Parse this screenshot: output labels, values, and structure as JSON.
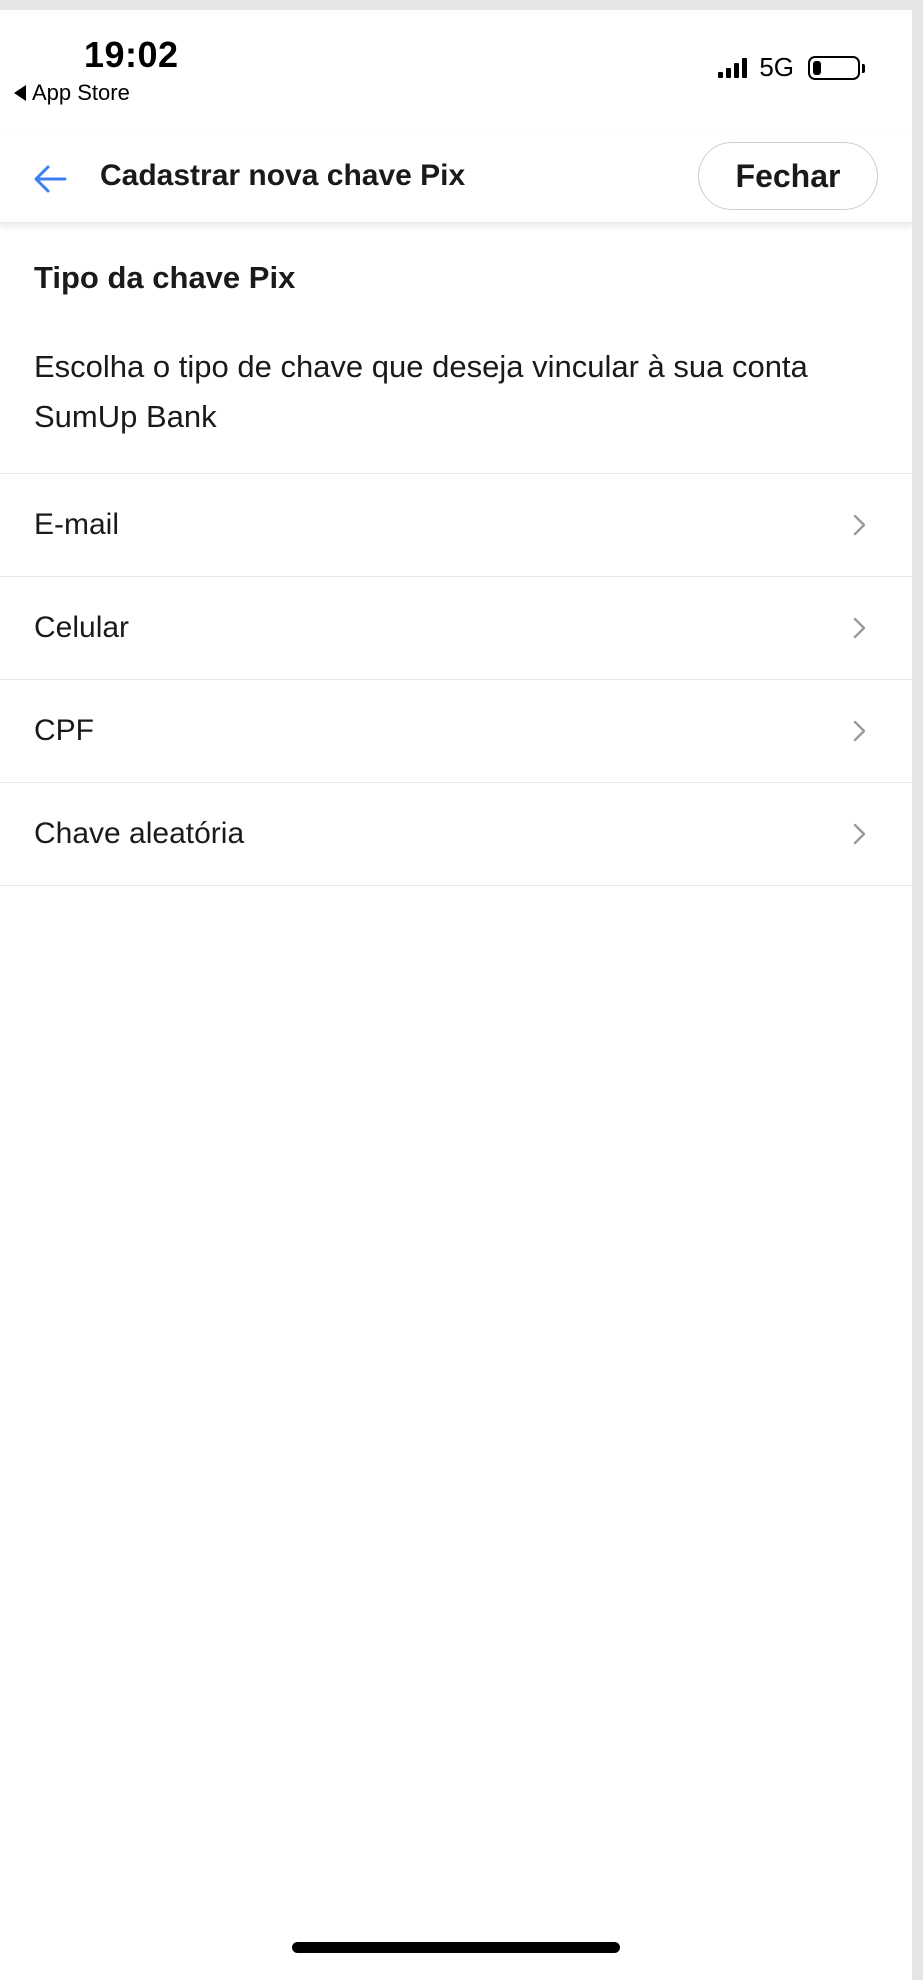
{
  "status_bar": {
    "time": "19:02",
    "back_app": "App Store",
    "network": "5G",
    "battery_level": 0.2
  },
  "header": {
    "title": "Cadastrar nova chave Pix",
    "close_label": "Fechar"
  },
  "content": {
    "section_title": "Tipo da chave Pix",
    "description": "Escolha o tipo de chave que deseja vincular à sua conta SumUp Bank",
    "key_types": [
      {
        "label": "E-mail"
      },
      {
        "label": "Celular"
      },
      {
        "label": "CPF"
      },
      {
        "label": "Chave aleatória"
      }
    ]
  },
  "colors": {
    "accent": "#3d7ff0",
    "text": "#1a1a1a",
    "chevron": "#9a9a9a",
    "divider": "#e6e6e6"
  }
}
